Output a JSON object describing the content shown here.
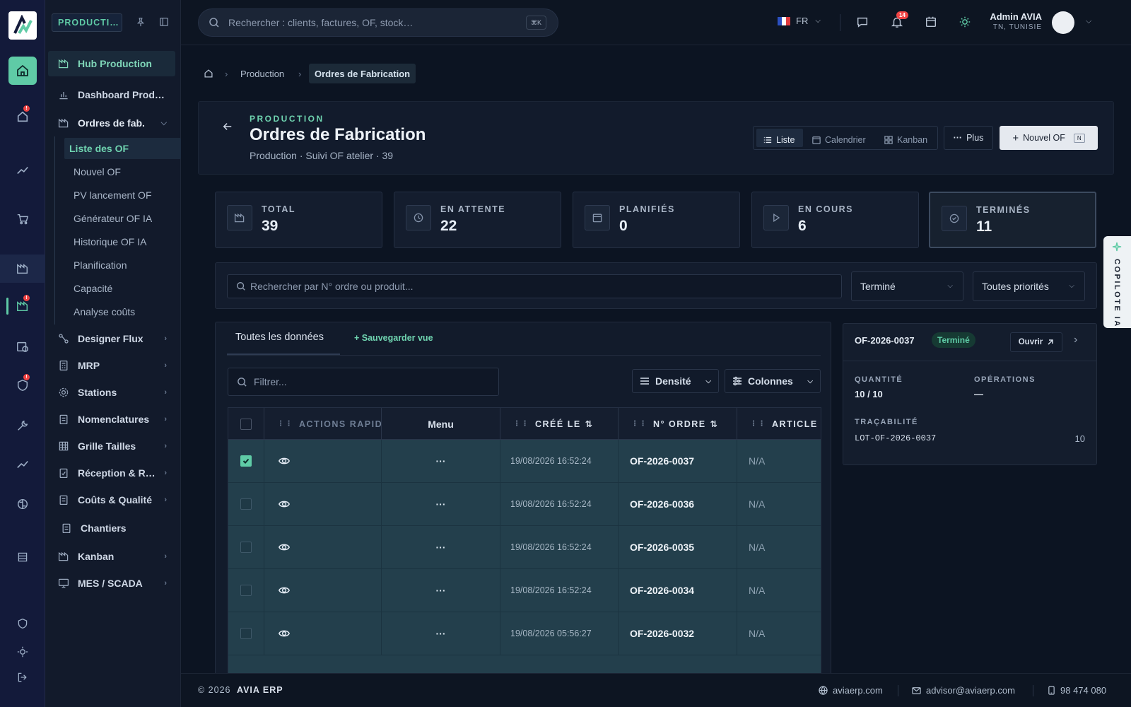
{
  "app": {
    "module_tag": "PRODUCTI…"
  },
  "topbar": {
    "search_placeholder": "Rechercher : clients, factures, OF, stock…",
    "search_shortcut": "⌘K",
    "language": "FR",
    "notification_count": "14",
    "user_name": "Admin AVIA",
    "user_location": "TN, TUNISIE"
  },
  "sidebar": {
    "items": [
      {
        "label": "Hub Production"
      },
      {
        "label": "Dashboard Prod…"
      },
      {
        "label": "Ordres de fab."
      },
      {
        "label": "Designer Flux"
      },
      {
        "label": "MRP"
      },
      {
        "label": "Stations"
      },
      {
        "label": "Nomenclatures"
      },
      {
        "label": "Grille Tailles"
      },
      {
        "label": "Réception & R…"
      },
      {
        "label": "Coûts & Qualité"
      },
      {
        "label": "Chantiers"
      },
      {
        "label": "Kanban"
      },
      {
        "label": "MES / SCADA"
      }
    ],
    "subitems": [
      {
        "label": "Liste des OF"
      },
      {
        "label": "Nouvel OF"
      },
      {
        "label": "PV lancement OF"
      },
      {
        "label": "Générateur OF IA"
      },
      {
        "label": "Historique OF IA"
      },
      {
        "label": "Planification"
      },
      {
        "label": "Capacité"
      },
      {
        "label": "Analyse coûts"
      }
    ]
  },
  "breadcrumb": {
    "level1": "Production",
    "current": "Ordres de Fabrication"
  },
  "header": {
    "eyebrow": "PRODUCTION",
    "title": "Ordres de Fabrication",
    "subtitle": "Production · Suivi OF atelier · 39",
    "view_list": "Liste",
    "view_calendar": "Calendrier",
    "view_kanban": "Kanban",
    "more": "Plus",
    "new_button": "Nouvel OF",
    "new_shortcut": "N"
  },
  "stats": [
    {
      "label": "TOTAL",
      "value": "39"
    },
    {
      "label": "EN ATTENTE",
      "value": "22"
    },
    {
      "label": "PLANIFIÉS",
      "value": "0"
    },
    {
      "label": "EN COURS",
      "value": "6"
    },
    {
      "label": "TERMINÉS",
      "value": "11"
    }
  ],
  "filters": {
    "search_placeholder": "Rechercher par N° ordre ou produit...",
    "status": "Terminé",
    "priority": "Toutes priorités"
  },
  "table": {
    "tab_all": "Toutes les données",
    "save_view": "+ Sauvegarder vue",
    "filter_placeholder": "Filtrer...",
    "density": "Densité",
    "columns_btn": "Colonnes",
    "headers": {
      "actions": "ACTIONS RAPIDES",
      "menu": "Menu",
      "created": "CRÉÉ LE",
      "order": "N° ORDRE",
      "article": "ARTICLE / PRODUIT"
    },
    "rows": [
      {
        "created": "19/08/2026 16:52:24",
        "order": "OF-2026-0037",
        "article": "N/A"
      },
      {
        "created": "19/08/2026 16:52:24",
        "order": "OF-2026-0036",
        "article": "N/A"
      },
      {
        "created": "19/08/2026 16:52:24",
        "order": "OF-2026-0035",
        "article": "N/A"
      },
      {
        "created": "19/08/2026 16:52:24",
        "order": "OF-2026-0034",
        "article": "N/A"
      },
      {
        "created": "19/08/2026 05:56:27",
        "order": "OF-2026-0032",
        "article": "N/A"
      }
    ]
  },
  "detail": {
    "id": "OF-2026-0037",
    "status": "Terminé",
    "open": "Ouvrir",
    "qty_label": "QUANTITÉ",
    "qty_value": "10 / 10",
    "ops_label": "OPÉRATIONS",
    "ops_value": "—",
    "trace_label": "TRAÇABILITÉ",
    "lot": "LOT-OF-2026-0037",
    "lot_qty": "10"
  },
  "copilot": {
    "label": "COPILOTE IA"
  },
  "footer": {
    "copyright": "© 2026",
    "brand": "AVIA ERP",
    "site": "aviaerp.com",
    "email": "advisor@aviaerp.com",
    "phone": "98 474 080"
  },
  "colors": {
    "accent": "#5fcba6",
    "badge": "#ef4444",
    "row_bg": "#233f4c"
  }
}
